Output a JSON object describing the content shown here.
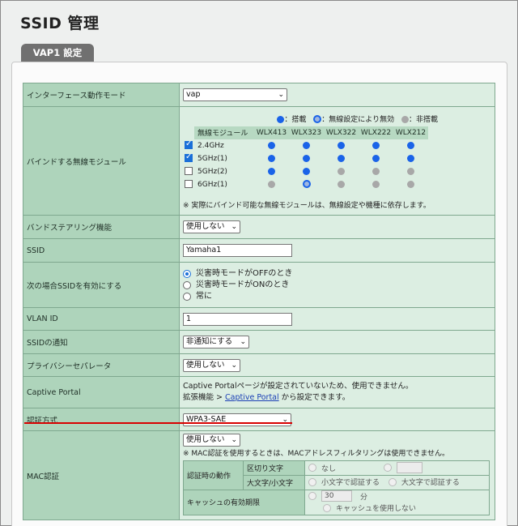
{
  "page": {
    "title": "SSID 管理",
    "tab": "VAP1 設定"
  },
  "rows": {
    "if_mode": {
      "label": "インターフェース動作モード",
      "value": "vap"
    },
    "bind": {
      "label": "バインドする無線モジュール",
      "legend": {
        "mounted": "：搭載",
        "disabled": "：無線設定により無効",
        "none": "：非搭載"
      },
      "header": [
        "無線モジュール",
        "WLX413",
        "WLX323",
        "WLX322",
        "WLX222",
        "WLX212"
      ],
      "modules": [
        {
          "name": "2.4GHz",
          "checked": true,
          "status": [
            "blue",
            "blue",
            "blue",
            "blue",
            "blue"
          ]
        },
        {
          "name": "5GHz(1)",
          "checked": true,
          "status": [
            "blue",
            "blue",
            "blue",
            "blue",
            "blue"
          ]
        },
        {
          "name": "5GHz(2)",
          "checked": false,
          "status": [
            "blue",
            "blue",
            "gray",
            "gray",
            "gray"
          ]
        },
        {
          "name": "6GHz(1)",
          "checked": false,
          "status": [
            "gray",
            "ring",
            "gray",
            "gray",
            "gray"
          ]
        }
      ],
      "note": "※ 実際にバインド可能な無線モジュールは、無線設定や機種に依存します。"
    },
    "band_steering": {
      "label": "バンドステアリング機能",
      "value": "使用しない"
    },
    "ssid": {
      "label": "SSID",
      "value": "Yamaha1"
    },
    "ssid_enable": {
      "label": "次の場合SSIDを有効にする",
      "options": [
        "災害時モードがOFFのとき",
        "災害時モードがONのとき",
        "常に"
      ]
    },
    "vlan": {
      "label": "VLAN ID",
      "value": "1"
    },
    "ssid_notify": {
      "label": "SSIDの通知",
      "value": "非通知にする"
    },
    "privacy": {
      "label": "プライバシーセパレータ",
      "value": "使用しない"
    },
    "captive": {
      "label": "Captive Portal",
      "line1": "Captive Portalページが設定されていないため、使用できません。",
      "line2_pre": "拡張機能 > ",
      "link": "Captive Portal",
      "line2_post": " から設定できます。"
    },
    "auth": {
      "label": "認証方式",
      "value": "WPA3-SAE"
    },
    "mac_auth": {
      "label": "MAC認証",
      "value": "使用しない",
      "note": "※ MAC認証を使用するときは、MACアドレスフィルタリングは使用できません。",
      "behavior_label": "認証時の動作",
      "delimiter_label": "区切り文字",
      "delimiter_none": "なし",
      "case_label": "大文字/小文字",
      "case_lower": "小文字で認証する",
      "case_upper": "大文字で認証する",
      "cache_label": "キャッシュの有効期限",
      "cache_value": "30",
      "cache_unit": "分",
      "cache_none": "キャッシュを使用しない"
    }
  },
  "colors": {
    "label_bg": "#aed4bb",
    "value_bg": "#dceee2",
    "tab_bg": "#707070",
    "accent_blue": "#1a63e8",
    "highlight_red": "#d80000"
  }
}
